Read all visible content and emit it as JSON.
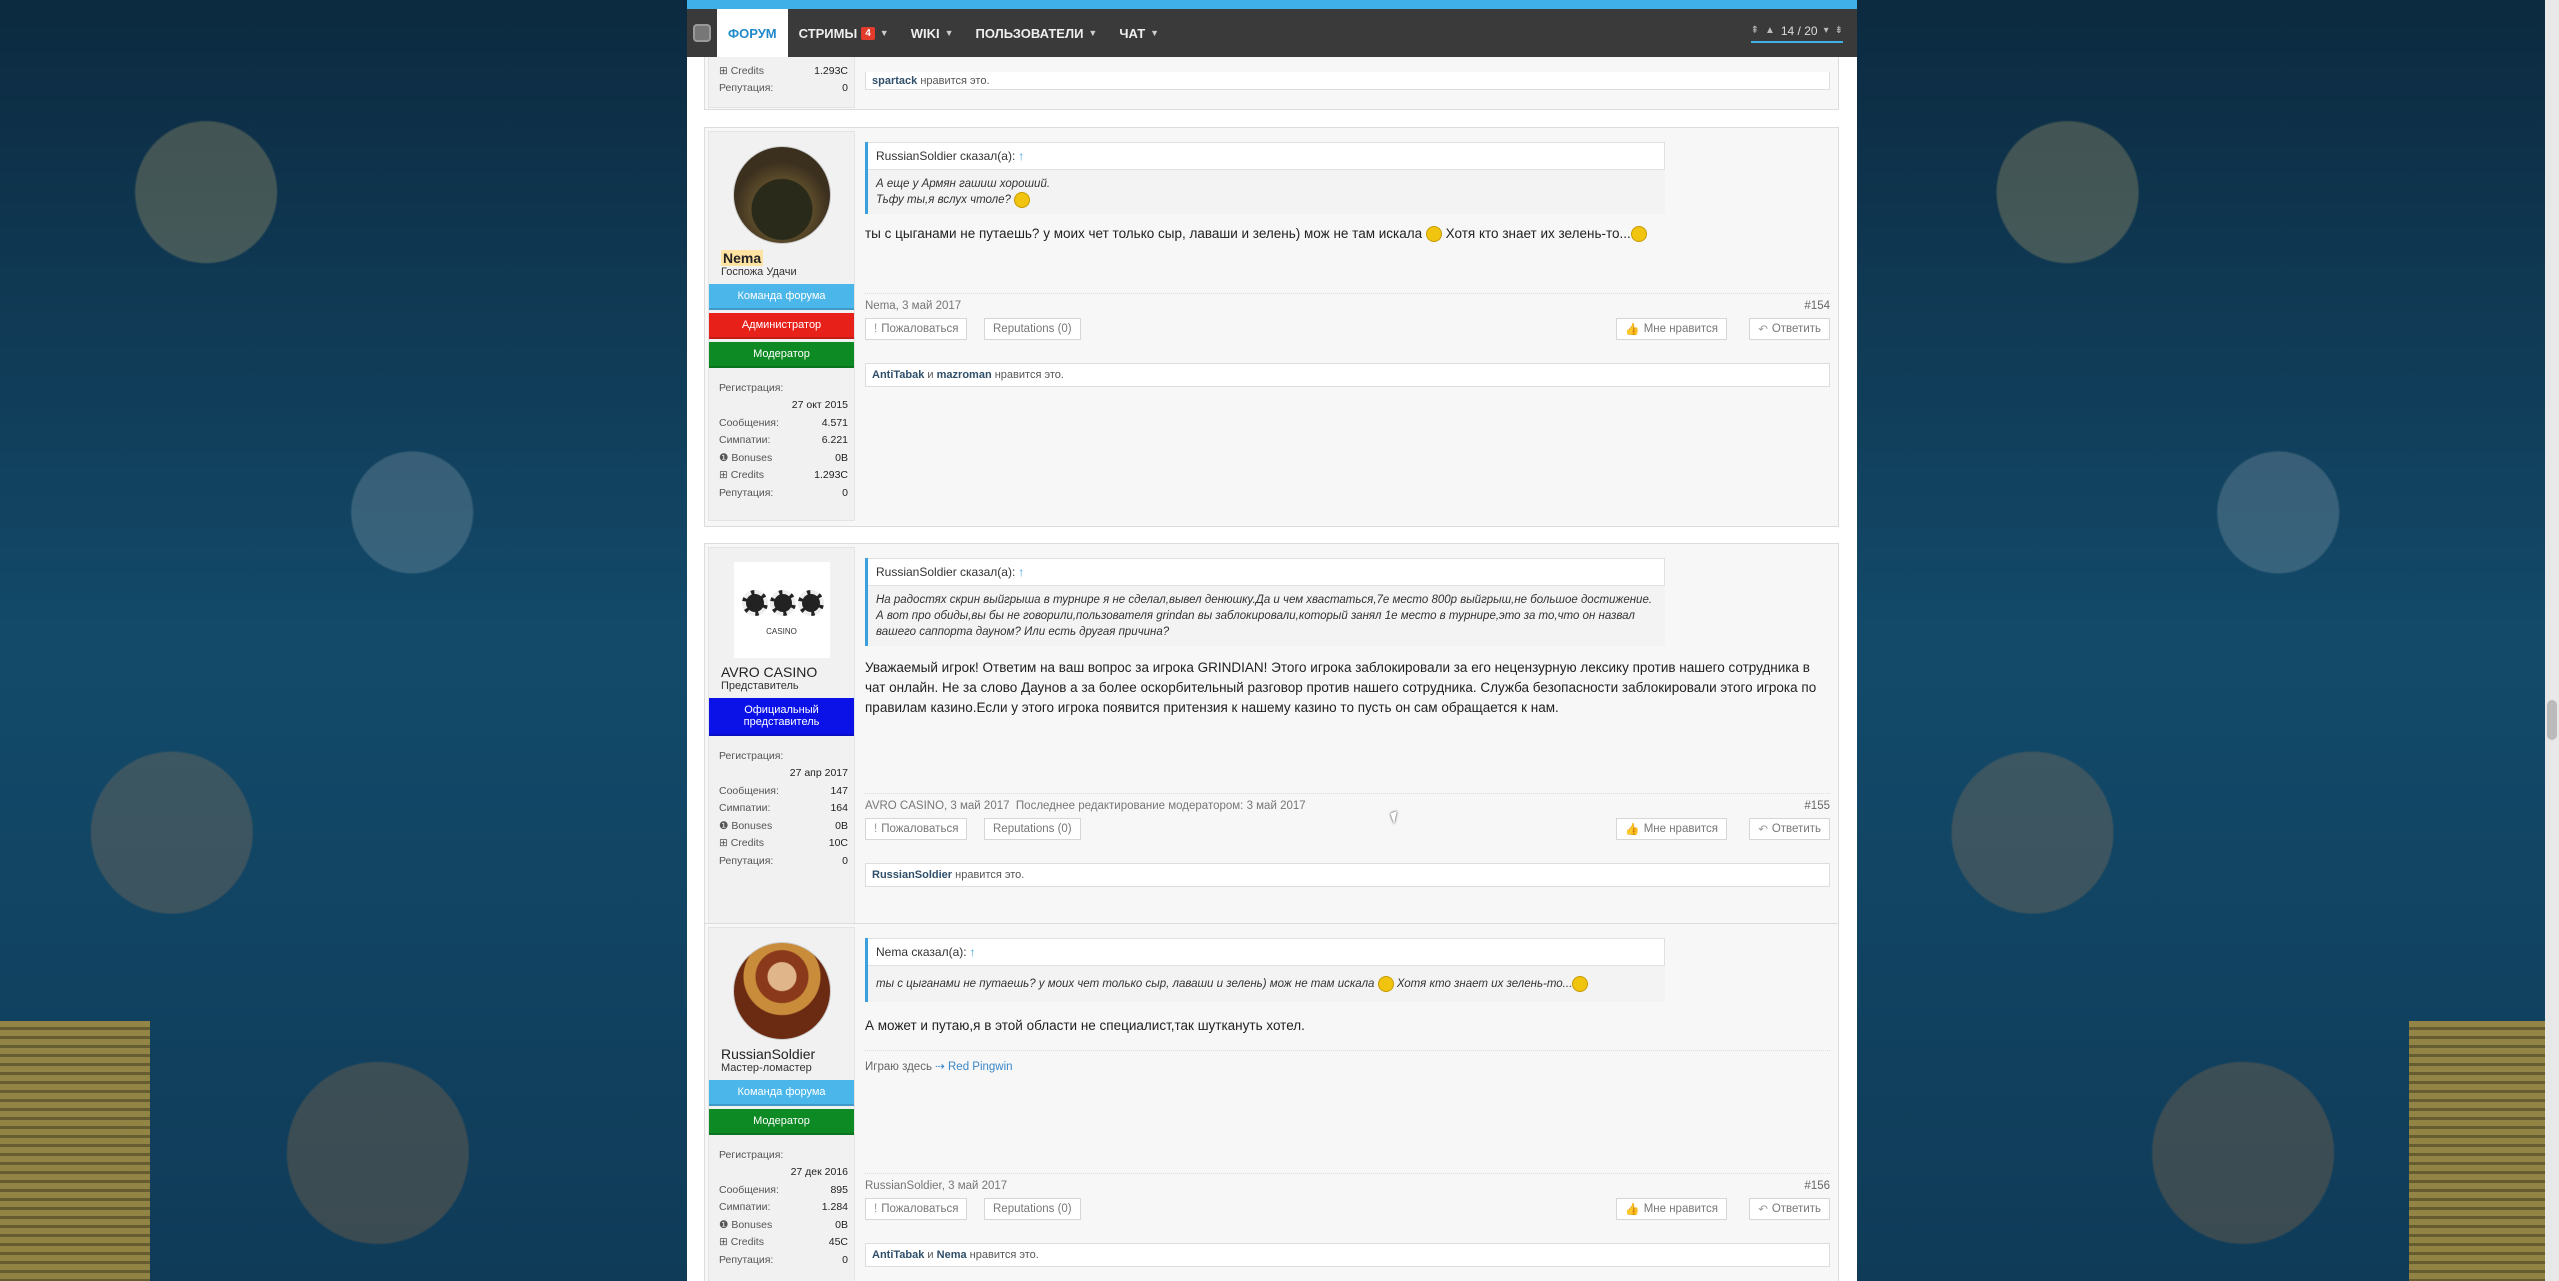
{
  "nav": {
    "items": [
      {
        "label": "ФОРУМ"
      },
      {
        "label": "СТРИМЫ",
        "badge": "4"
      },
      {
        "label": "WIKI"
      },
      {
        "label": "ПОЛЬЗОВАТЕЛИ"
      },
      {
        "label": "ЧАТ"
      }
    ],
    "pager": "14 / 20"
  },
  "prev_post": {
    "credits_label": "Credits",
    "credits_val": "1.293C",
    "rep_label": "Репутация:",
    "rep_val": "0",
    "likes_user": "spartack",
    "likes_suffix": "нравится это."
  },
  "posts": [
    {
      "user": {
        "name": "Nema",
        "title": "Госпожа Удачи",
        "roles": [
          {
            "label": "Команда форума",
            "color": "#4ab6ea"
          },
          {
            "label": "Администратор",
            "color": "#e8201a"
          },
          {
            "label": "Модератор",
            "color": "#0e8a24"
          }
        ],
        "reg_label": "Регистрация:",
        "reg_date": "27 окт 2015",
        "stats": [
          {
            "label": "Сообщения:",
            "value": "4.571"
          },
          {
            "label": "Симпатии:",
            "value": "6.221"
          },
          {
            "label": "Bonuses",
            "value": "0B"
          },
          {
            "label": "Credits",
            "value": "1.293C"
          },
          {
            "label": "Репутация:",
            "value": "0"
          }
        ]
      },
      "quote_author": "RussianSoldier сказал(а):",
      "quote_lines": [
        "А еще у Армян гашиш хороший.",
        "Тьфу ты,я вслух чтоле?"
      ],
      "message": "ты с цыганами не путаешь? у моих чет только сыр, лаваши и зелень) мож не там искала",
      "message_tail": "Хотя кто знает их зелень-то...",
      "meta": "Nema, 3 май 2017",
      "number": "#154",
      "likes_users": [
        "AntiTabak",
        "mazroman"
      ],
      "likes_and": "и",
      "likes_suffix": "нравится это."
    },
    {
      "user": {
        "name": "AVRO CASINO",
        "title": "Представитель",
        "roles": [
          {
            "label": "Официальный представитель",
            "color": "#0a12e8"
          }
        ],
        "avatar_text": "CASINO",
        "reg_label": "Регистрация:",
        "reg_date": "27 апр 2017",
        "stats": [
          {
            "label": "Сообщения:",
            "value": "147"
          },
          {
            "label": "Симпатии:",
            "value": "164"
          },
          {
            "label": "Bonuses",
            "value": "0B"
          },
          {
            "label": "Credits",
            "value": "10C"
          },
          {
            "label": "Репутация:",
            "value": "0"
          }
        ]
      },
      "quote_author": "RussianSoldier сказал(а):",
      "quote_lines": [
        "На радостях скрин выйгрыша в турнире я не сделал,вывел денюшку.Да и чем хвастаться,7е место 800р выйгрыш,не большое достижение.",
        "А вот про обиды,вы бы не говорили,пользователя grindan вы заблокировали,который занял 1е место в турнире,это за то,что он назвал вашего саппорта дауном? Или есть другая причина?"
      ],
      "message": "Уважаемый игрок! Ответим на ваш вопрос за игрока GRINDIAN! Этого игрока заблокировали за его нецензурную лексику против нашего сотрудника в чат онлайн. Не за слово Даунов а за более оскорбительный разговор против нашего сотрудника. Служба безопасности заблокировали этого игрока по правилам казино.Если у этого игрока появится притензия к нашему казино то пусть он сам обращается к нам.",
      "meta": "AVRO CASINO, 3 май 2017",
      "meta_edit": "Последнее редактирование модератором: 3 май 2017",
      "number": "#155",
      "likes_users": [
        "RussianSoldier"
      ],
      "likes_suffix": "нравится это."
    },
    {
      "user": {
        "name": "RussianSoldier",
        "title": "Мастер-ломастер",
        "roles": [
          {
            "label": "Команда форума",
            "color": "#4ab6ea"
          },
          {
            "label": "Модератор",
            "color": "#0e8a24"
          }
        ],
        "reg_label": "Регистрация:",
        "reg_date": "27 дек 2016",
        "stats": [
          {
            "label": "Сообщения:",
            "value": "895"
          },
          {
            "label": "Симпатии:",
            "value": "1.284"
          },
          {
            "label": "Bonuses",
            "value": "0B"
          },
          {
            "label": "Credits",
            "value": "45C"
          },
          {
            "label": "Репутация:",
            "value": "0"
          }
        ]
      },
      "quote_author": "Nema сказал(а):",
      "quote_lines": [
        "ты с цыганами не путаешь? у моих чет только сыр, лаваши и зелень) мож не там искала",
        "Хотя кто знает их зелень-то..."
      ],
      "message": "А может и путаю,я в этой области не специалист,так шуткануть хотел.",
      "signature_prefix": "Играю здесь",
      "signature_link": "Red Pingwin",
      "meta": "RussianSoldier, 3 май 2017",
      "number": "#156",
      "likes_users": [
        "AntiTabak",
        "Nema"
      ],
      "likes_and": "и",
      "likes_suffix": "нравится это."
    }
  ],
  "buttons": {
    "report": "Пожаловаться",
    "reputations": "Reputations (0)",
    "like": "Мне нравится",
    "reply": "Ответить"
  },
  "colors": {
    "accent": "#3fb1e8",
    "nav_bg": "#3a3a3a"
  }
}
